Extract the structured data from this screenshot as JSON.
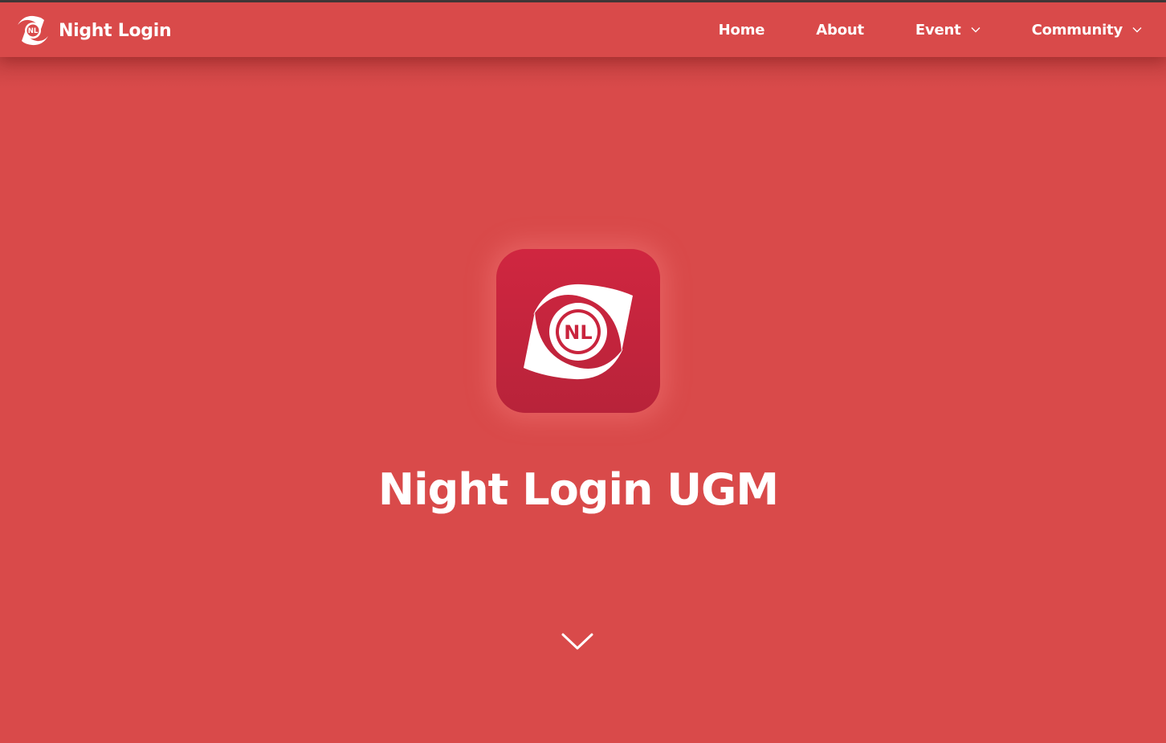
{
  "brand": {
    "name": "Night Login",
    "logo_text": "NL"
  },
  "nav": {
    "items": [
      {
        "label": "Home",
        "has_dropdown": false
      },
      {
        "label": "About",
        "has_dropdown": false
      },
      {
        "label": "Event",
        "has_dropdown": true
      },
      {
        "label": "Community",
        "has_dropdown": true
      }
    ]
  },
  "hero": {
    "title": "Night Login UGM",
    "logo_text": "NL",
    "scroll_icon": "chevron-down-icon"
  },
  "colors": {
    "primary": "#d94a4a",
    "icon_top": "#d02640",
    "icon_bottom": "#b8233a",
    "text": "#ffffff"
  }
}
